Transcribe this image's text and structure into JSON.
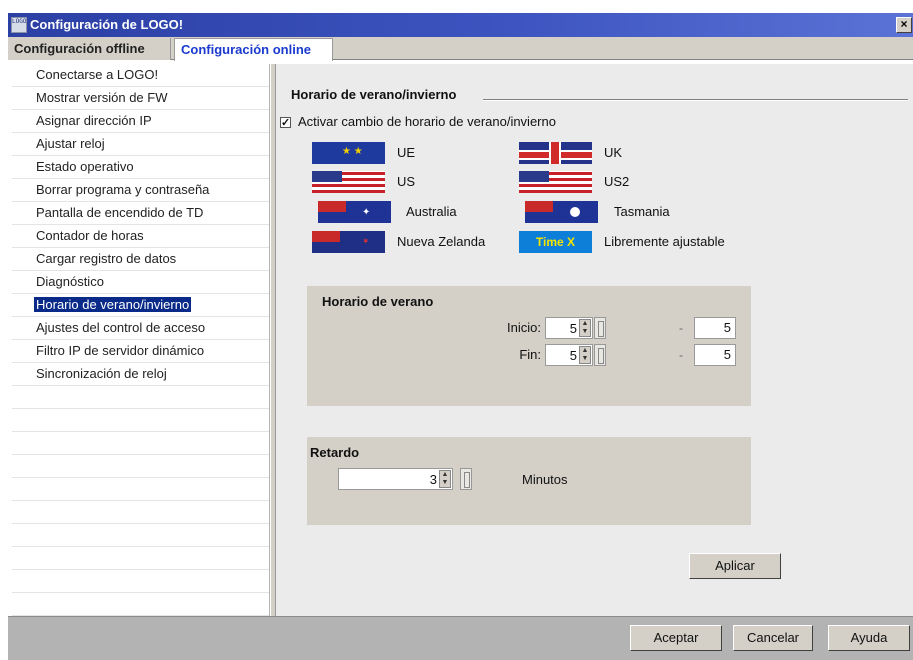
{
  "window": {
    "title": "Configuración de LOGO!",
    "close_glyph": "×",
    "icon_text": "LOGO"
  },
  "tabs": [
    {
      "label": "Configuración offline"
    },
    {
      "label": "Configuración online"
    }
  ],
  "sidebar": {
    "items": [
      {
        "label": "Conectarse a LOGO!"
      },
      {
        "label": "Mostrar versión de FW"
      },
      {
        "label": "Asignar dirección IP"
      },
      {
        "label": "Ajustar reloj"
      },
      {
        "label": "Estado operativo"
      },
      {
        "label": "Borrar programa y contraseña"
      },
      {
        "label": "Pantalla de encendido de TD"
      },
      {
        "label": "Contador de horas"
      },
      {
        "label": "Cargar registro de datos"
      },
      {
        "label": "Diagnóstico"
      },
      {
        "label": "Horario de verano/invierno"
      },
      {
        "label": "Ajustes del control de acceso"
      },
      {
        "label": "Filtro IP de servidor dinámico"
      },
      {
        "label": "Sincronización de reloj"
      }
    ],
    "selected": "Horario de verano/invierno"
  },
  "content": {
    "section_title": "Horario de verano/invierno",
    "checkbox": {
      "label": "Activar cambio de horario de verano/invierno",
      "checked": true,
      "glyph": "✓"
    },
    "regions": [
      {
        "label": "UE",
        "icon": "eu-flag-icon"
      },
      {
        "label": "UK",
        "icon": "uk-flag-icon"
      },
      {
        "label": "US",
        "icon": "us-flag-icon"
      },
      {
        "label": "US2",
        "icon": "us-flag-icon"
      },
      {
        "label": "Australia",
        "icon": "australia-flag-icon"
      },
      {
        "label": "Tasmania",
        "icon": "tasmania-flag-icon"
      },
      {
        "label": "Nueva Zelanda",
        "icon": "new-zealand-flag-icon"
      },
      {
        "label": "Libremente ajustable",
        "icon": "time-x-icon",
        "icon_text": "Time X"
      }
    ],
    "summer": {
      "title": "Horario de verano",
      "inicio_label": "Inicio:",
      "inicio_value": "5",
      "inicio_end_value": "5",
      "fin_label": "Fin:",
      "fin_value": "5",
      "fin_end_value": "5",
      "separator": "-"
    },
    "delay": {
      "title": "Retardo",
      "value": "3",
      "unit": "Minutos"
    },
    "apply_label": "Aplicar"
  },
  "footer": {
    "accept_label": "Aceptar",
    "cancel_label": "Cancelar",
    "help_label": "Ayuda"
  },
  "colors": {
    "titlebar": "#2b3fa4",
    "selected_item": "#0a2a8a",
    "active_tab_text": "#1a3ad0"
  }
}
